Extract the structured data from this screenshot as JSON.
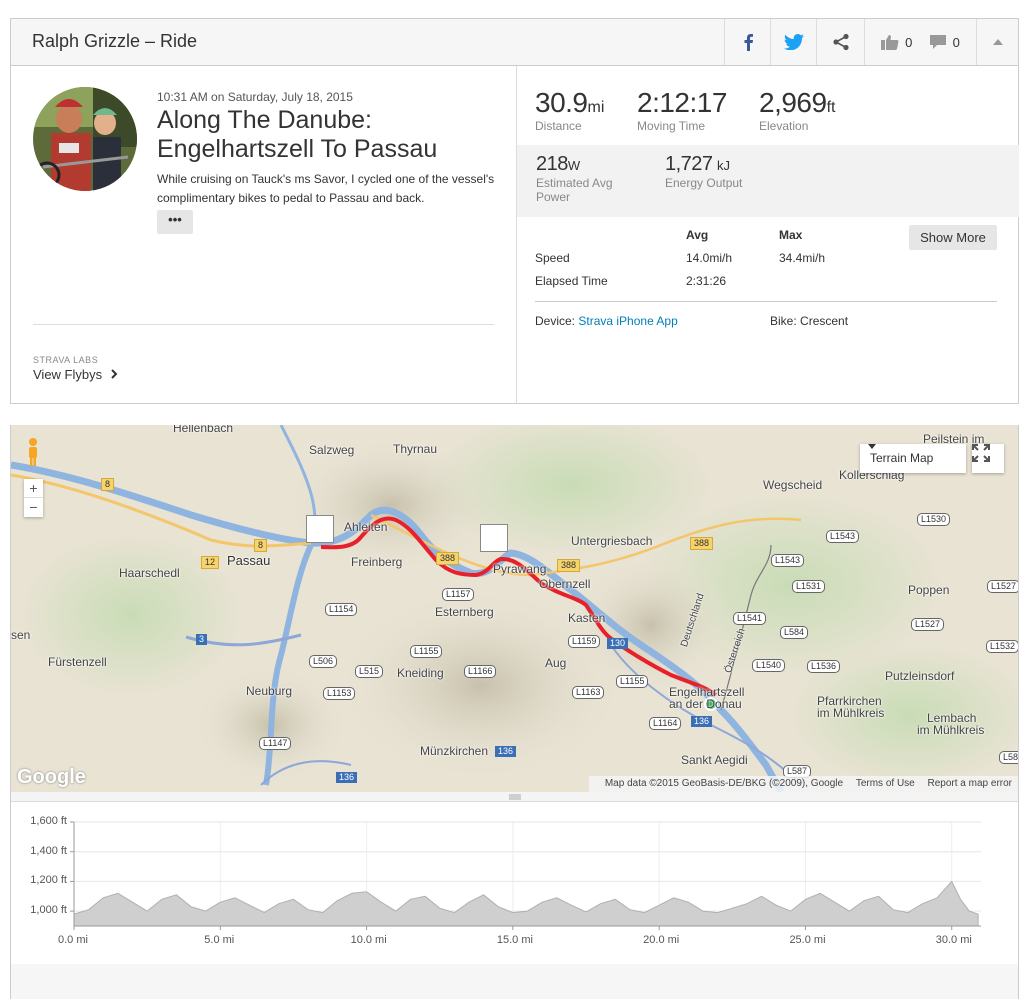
{
  "header": {
    "title": "Ralph Grizzle – Ride",
    "kudos_count": "0",
    "comments_count": "0"
  },
  "activity": {
    "date": "10:31 AM on Saturday, July 18, 2015",
    "title": "Along The Danube: Engelhartszell To Passau",
    "description": "While cruising on Tauck's ms Savor, I cycled one of the vessel's complimentary bikes to pedal to Passau and back.",
    "more_label": "•••",
    "labs_label": "STRAVA LABS",
    "flyby_label": "View Flybys"
  },
  "stats": {
    "distance": {
      "value": "30.9",
      "unit": "mi",
      "label": "Distance"
    },
    "moving_time": {
      "value": "2:12:17",
      "label": "Moving Time"
    },
    "elevation": {
      "value": "2,969",
      "unit": "ft",
      "label": "Elevation"
    },
    "power": {
      "value": "218",
      "unit": "W",
      "label_1": "Estimated Avg",
      "label_2": "Power"
    },
    "energy": {
      "value": "1,727",
      "unit": "kJ",
      "label": "Energy Output"
    },
    "table": {
      "avg_header": "Avg",
      "max_header": "Max",
      "speed_label": "Speed",
      "speed_avg": "14.0mi/h",
      "speed_max": "34.4mi/h",
      "elapsed_label": "Elapsed Time",
      "elapsed_avg": "2:31:26"
    },
    "show_more": "Show More",
    "device_label": "Device:",
    "device_value": "Strava iPhone App",
    "bike_label": "Bike:",
    "bike_value": "Crescent"
  },
  "map": {
    "type_button": "Terrain Map",
    "zoom_in": "+",
    "zoom_out": "−",
    "logo": "Google",
    "attribution": "Map data ©2015 GeoBasis-DE/BKG (©2009), Google",
    "terms": "Terms of Use",
    "report": "Report a map error",
    "places": {
      "hellenbach": "Hellenbach",
      "salzweg": "Salzweg",
      "thyrnau": "Thyrnau",
      "peilstein": "Peilstein im",
      "kollerschlag": "Kollerschlag",
      "wegscheid": "Wegscheid",
      "ahleiten": "Ahleiten",
      "untergriesbach": "Untergriesbach",
      "haarschedl": "Haarschedl",
      "passau": "Passau",
      "freinberg": "Freinberg",
      "pyrawang": "Pyrawang",
      "obernzell": "Obernzell",
      "esternberg": "Esternberg",
      "poppen": "Poppen",
      "kasten": "Kasten",
      "sen": "sen",
      "furstenzell": "Fürstenzell",
      "kneiding": "Kneiding",
      "aug": "Aug",
      "putzleinsdorf": "Putzleinsdorf",
      "neuburg": "Neuburg",
      "engel_1": "Engelhartszell",
      "engel_2": "an der Donau",
      "pfarr_1": "Pfarrkirchen",
      "pfarr_2": "im Mühlkreis",
      "lembach_1": "Lembach",
      "lembach_2": "im Mühlkreis",
      "munzkirchen": "Münzkirchen",
      "aegidi": "Sankt Aegidi",
      "deutschland": "Deutschland",
      "osterreich": "Österreich"
    },
    "roads": {
      "r8a": "8",
      "r8b": "8",
      "r12": "12",
      "r388a": "388",
      "r388b": "388",
      "r388c": "388",
      "r3": "3",
      "r136a": "136",
      "r136b": "136",
      "r136c": "136",
      "r130": "130",
      "l1530": "L1530",
      "l1543a": "L1543",
      "l1543b": "L1543",
      "l1531": "L1531",
      "l1527a": "L1527",
      "l1527b": "L1527",
      "l1541": "L1541",
      "l584": "L584",
      "l1532": "L1532",
      "l1540": "L1540",
      "l1536": "L1536",
      "l1157": "L1157",
      "l1154": "L1154",
      "l1159": "L1159",
      "l1155a": "L1155",
      "l1155b": "L1155",
      "l506": "L506",
      "l515": "L515",
      "l1166": "L1166",
      "l1153": "L1153",
      "l1163": "L1163",
      "l1164": "L1164",
      "l1147": "L1147",
      "l587": "L587",
      "l58": "L58"
    }
  },
  "elevation_chart": {
    "y_ticks": [
      "1,600 ft",
      "1,400 ft",
      "1,200 ft",
      "1,000 ft"
    ],
    "x_ticks": [
      "0.0 mi",
      "5.0 mi",
      "10.0 mi",
      "15.0 mi",
      "20.0 mi",
      "25.0 mi",
      "30.0 mi"
    ]
  },
  "chart_data": {
    "type": "area",
    "xlabel": "",
    "ylabel": "",
    "x_unit": "mi",
    "y_unit": "ft",
    "xlim": [
      0,
      31
    ],
    "ylim": [
      900,
      1600
    ],
    "y_tick_values": [
      1000,
      1200,
      1400,
      1600
    ],
    "x_tick_values": [
      0,
      5,
      10,
      15,
      20,
      25,
      30
    ],
    "grid": true,
    "series": [
      {
        "x": [
          0.0,
          0.5,
          1.0,
          1.5,
          2.0,
          2.5,
          3.0,
          3.5,
          4.0,
          4.5,
          5.0,
          5.5,
          6.0,
          6.5,
          7.0,
          7.5,
          8.0,
          8.5,
          9.0,
          9.5,
          10.0,
          10.5,
          11.0,
          11.5,
          12.0,
          12.5,
          13.0,
          13.5,
          14.0,
          14.5,
          15.0,
          15.5,
          16.0,
          16.5,
          17.0,
          17.5,
          18.0,
          18.5,
          19.0,
          19.5,
          20.0,
          20.5,
          21.0,
          21.5,
          22.0,
          22.5,
          23.0,
          23.5,
          24.0,
          24.5,
          25.0,
          25.5,
          26.0,
          26.5,
          27.0,
          27.5,
          28.0,
          28.5,
          29.0,
          29.5,
          30.0,
          30.3,
          30.6,
          30.9
        ],
        "y": [
          980,
          1010,
          1090,
          1120,
          1060,
          1000,
          1080,
          1110,
          1030,
          1000,
          1060,
          1090,
          1040,
          990,
          1050,
          1080,
          1010,
          990,
          1070,
          1120,
          1130,
          1060,
          1000,
          1080,
          1100,
          1020,
          990,
          1060,
          1110,
          1030,
          990,
          1000,
          1060,
          1090,
          1040,
          995,
          1050,
          1080,
          1010,
          990,
          1040,
          1090,
          1060,
          1000,
          990,
          1020,
          1050,
          1100,
          1040,
          1000,
          1080,
          1120,
          1060,
          1000,
          1070,
          1100,
          1010,
          990,
          1050,
          1090,
          1200,
          1080,
          1000,
          980
        ]
      }
    ]
  }
}
